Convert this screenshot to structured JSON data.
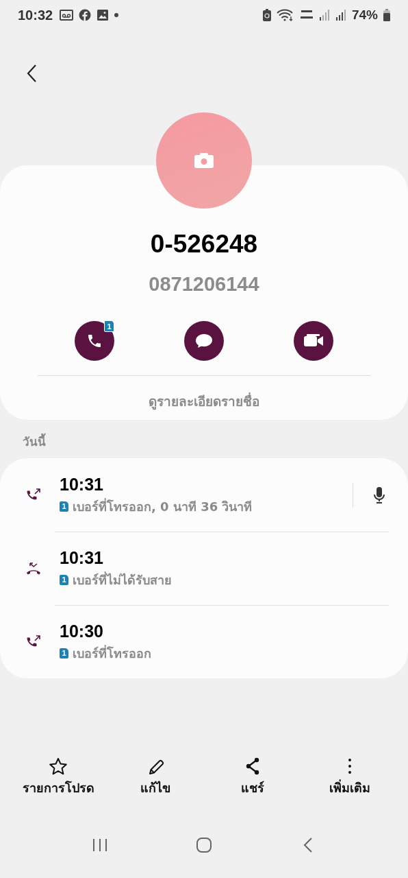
{
  "status_bar": {
    "time": "10:32",
    "battery": "74%"
  },
  "contact": {
    "name": "0-526248",
    "number": "0871206144"
  },
  "actions": [
    {
      "kind": "call",
      "sim": "1"
    },
    {
      "kind": "message"
    },
    {
      "kind": "video"
    }
  ],
  "details_link": "ดูรายละเอียดรายชื่อ",
  "section_title": "วันนี้",
  "calls": [
    {
      "kind": "outgoing",
      "time": "10:31",
      "sim": "1",
      "description": "เบอร์ที่โทรออก, 0 นาที 36 วินาที",
      "has_recording": true
    },
    {
      "kind": "missed",
      "time": "10:31",
      "sim": "1",
      "description": "เบอร์ที่ไม่ได้รับสาย",
      "has_recording": false
    },
    {
      "kind": "outgoing",
      "time": "10:30",
      "sim": "1",
      "description": "เบอร์ที่โทรออก",
      "has_recording": false
    }
  ],
  "toolbar": [
    {
      "kind": "favorite",
      "label": "รายการโปรด"
    },
    {
      "kind": "edit",
      "label": "แก้ไข"
    },
    {
      "kind": "share",
      "label": "แชร์"
    },
    {
      "kind": "more",
      "label": "เพิ่มเติม"
    }
  ]
}
